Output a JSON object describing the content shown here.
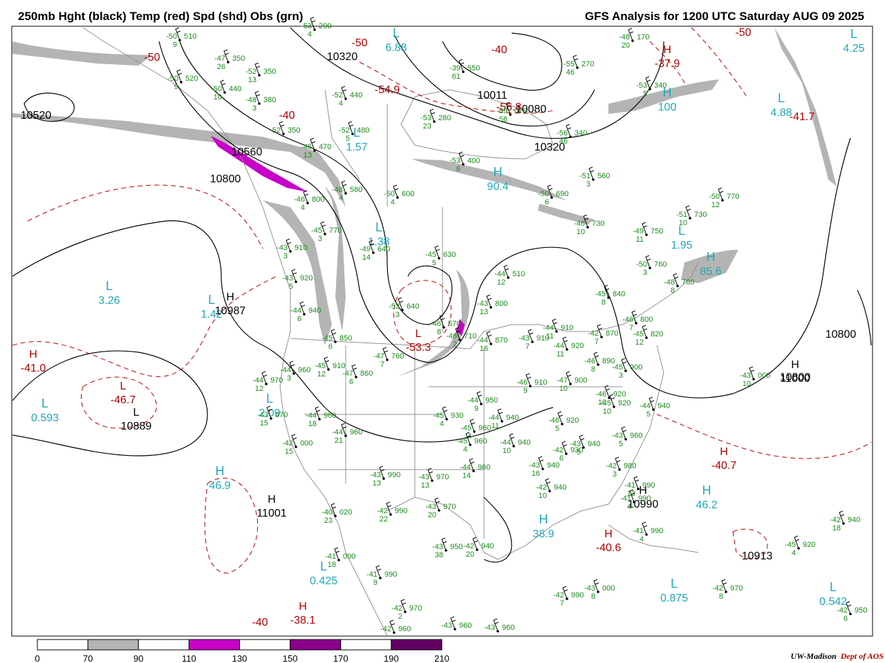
{
  "header": {
    "left_title": "250mb Hght (black) Temp (red) Spd (shd) Obs (grn)",
    "right_title": "GFS Analysis for 1200 UTC Saturday  AUG 09 2025"
  },
  "colorbar": {
    "ticks": [
      "0",
      "70",
      "90",
      "110",
      "130",
      "150",
      "170",
      "190",
      "210"
    ],
    "fills": [
      "#ffffff",
      "#b4b4b4",
      "#ffffff",
      "#c800c8",
      "#ffffff",
      "#8c008c",
      "#ffffff",
      "#640064"
    ]
  },
  "credit": {
    "org": "UW-Madison",
    "dept": "Dept of AOS"
  },
  "map": {
    "pressure_centers": [
      {
        "letter": "L",
        "color": "cyan",
        "value": "3.26"
      },
      {
        "letter": "L",
        "color": "cyan",
        "value": "1.42"
      },
      {
        "letter": "L",
        "color": "cyan",
        "value": "0.593"
      },
      {
        "letter": "L",
        "color": "cyan",
        "value": "1.38"
      },
      {
        "letter": "L",
        "color": "cyan",
        "value": "1.57"
      },
      {
        "letter": "L",
        "color": "cyan",
        "value": "6.88"
      },
      {
        "letter": "L",
        "color": "cyan",
        "value": "4.88"
      },
      {
        "letter": "L",
        "color": "cyan",
        "value": "4.25"
      },
      {
        "letter": "L",
        "color": "cyan",
        "value": "1.95"
      },
      {
        "letter": "L",
        "color": "cyan",
        "value": "0.425"
      },
      {
        "letter": "L",
        "color": "cyan",
        "value": "0.875"
      },
      {
        "letter": "L",
        "color": "cyan",
        "value": "0.542"
      },
      {
        "letter": "L",
        "color": "cyan",
        "value": "2.09"
      },
      {
        "letter": "H",
        "color": "cyan",
        "value": "90.4"
      },
      {
        "letter": "H",
        "color": "cyan",
        "value": "85.6"
      },
      {
        "letter": "H",
        "color": "cyan",
        "value": "46.9"
      },
      {
        "letter": "H",
        "color": "cyan",
        "value": "38.9"
      },
      {
        "letter": "H",
        "color": "cyan",
        "value": "46.2"
      },
      {
        "letter": "H",
        "color": "cyan",
        "value": "100"
      },
      {
        "letter": "H",
        "color": "black",
        "value": "10987"
      },
      {
        "letter": "L",
        "color": "black",
        "value": "10889"
      },
      {
        "letter": "H",
        "color": "black",
        "value": "11001"
      },
      {
        "letter": "H",
        "color": "black",
        "value": "11000"
      },
      {
        "letter": "H",
        "color": "black",
        "value": "10990"
      },
      {
        "letter": "H",
        "color": "red",
        "value": "-41.0"
      },
      {
        "letter": "L",
        "color": "red",
        "value": "-46.7"
      },
      {
        "letter": "H",
        "color": "red",
        "value": "-40.7"
      },
      {
        "letter": "H",
        "color": "red",
        "value": "-40.6"
      },
      {
        "letter": "H",
        "color": "red",
        "value": "-38.1"
      },
      {
        "letter": "L",
        "color": "red",
        "value": "-53.3"
      },
      {
        "letter": "H",
        "color": "red",
        "value": "-37.9"
      }
    ],
    "height_labels": [
      "10320",
      "10011",
      "10080",
      "10320",
      "10800",
      "10800",
      "10800",
      "10560",
      "10520",
      "10913"
    ],
    "temp_labels": [
      "-50",
      "-50",
      "-40",
      "-50",
      "-40",
      "-54.9",
      "-56.8",
      "-41.7",
      "-40"
    ],
    "observations": [
      {
        "temp": "-50",
        "height": "510",
        "speed": "9"
      },
      {
        "temp": "-47",
        "height": "350",
        "speed": "26"
      },
      {
        "temp": "-52",
        "height": "350",
        "speed": "13"
      },
      {
        "temp": "-50",
        "height": "520",
        "speed": "9"
      },
      {
        "temp": "-50",
        "height": "440",
        "speed": "10"
      },
      {
        "temp": "-48",
        "height": "380",
        "speed": "3"
      },
      {
        "temp": "-52",
        "height": "350",
        "speed": ""
      },
      {
        "temp": "-52",
        "height": "440",
        "speed": "4"
      },
      {
        "temp": "-52",
        "height": "480",
        "speed": "5"
      },
      {
        "temp": "-53",
        "height": "290",
        "speed": "4"
      },
      {
        "temp": "-39",
        "height": "550",
        "speed": "61"
      },
      {
        "temp": "-53",
        "height": "280",
        "speed": "23"
      },
      {
        "temp": "-59",
        "height": "070",
        "speed": "58"
      },
      {
        "temp": "-55",
        "height": "270",
        "speed": "46"
      },
      {
        "temp": "-53",
        "height": "340",
        "speed": "5"
      },
      {
        "temp": "-56",
        "height": "340",
        "speed": "46"
      },
      {
        "temp": "-48",
        "height": "170",
        "speed": "20"
      },
      {
        "temp": "-45",
        "height": "470",
        "speed": "13"
      },
      {
        "temp": "-48",
        "height": "580",
        "speed": "4"
      },
      {
        "temp": "-50",
        "height": "600",
        "speed": "4"
      },
      {
        "temp": "-53",
        "height": "400",
        "speed": "6"
      },
      {
        "temp": "-51",
        "height": "560",
        "speed": "3"
      },
      {
        "temp": "-50",
        "height": "690",
        "speed": "6"
      },
      {
        "temp": "-46",
        "height": "800",
        "speed": "4"
      },
      {
        "temp": "-45",
        "height": "770",
        "speed": "3"
      },
      {
        "temp": "-49",
        "height": "640",
        "speed": "14"
      },
      {
        "temp": "-45",
        "height": "630",
        "speed": "5"
      },
      {
        "temp": "-46",
        "height": "730",
        "speed": "10"
      },
      {
        "temp": "-49",
        "height": "750",
        "speed": "11"
      },
      {
        "temp": "-51",
        "height": "730",
        "speed": "10"
      },
      {
        "temp": "-50",
        "height": "770",
        "speed": "12"
      },
      {
        "temp": "-43",
        "height": "910",
        "speed": "3"
      },
      {
        "temp": "-43",
        "height": "920",
        "speed": "5"
      },
      {
        "temp": "-44",
        "height": "940",
        "speed": "6"
      },
      {
        "temp": "-53",
        "height": "640",
        "speed": "3"
      },
      {
        "temp": "-46",
        "height": "570",
        "speed": "8"
      },
      {
        "temp": "-46",
        "height": "710",
        "speed": "2"
      },
      {
        "temp": "-44",
        "height": "510",
        "speed": "12"
      },
      {
        "temp": "-43",
        "height": "800",
        "speed": "13"
      },
      {
        "temp": "-50",
        "height": "760",
        "speed": "3"
      },
      {
        "temp": "-48",
        "height": "780",
        "speed": "8"
      },
      {
        "temp": "-45",
        "height": "840",
        "speed": "8"
      },
      {
        "temp": "-45",
        "height": "850",
        "speed": "6"
      },
      {
        "temp": "-47",
        "height": "760",
        "speed": "7"
      },
      {
        "temp": "-44",
        "height": "870",
        "speed": "16"
      },
      {
        "temp": "-43",
        "height": "910",
        "speed": "7"
      },
      {
        "temp": "-44",
        "height": "910",
        "speed": "11"
      },
      {
        "temp": "-44",
        "height": "920",
        "speed": "11"
      },
      {
        "temp": "-42",
        "height": "870",
        "speed": "7"
      },
      {
        "temp": "-46",
        "height": "800",
        "speed": "7"
      },
      {
        "temp": "-45",
        "height": "820",
        "speed": "12"
      },
      {
        "temp": "-44",
        "height": "960",
        "speed": "3"
      },
      {
        "temp": "-45",
        "height": "910",
        "speed": "12"
      },
      {
        "temp": "-47",
        "height": "860",
        "speed": "6"
      },
      {
        "temp": "-44",
        "height": "970",
        "speed": "12"
      },
      {
        "temp": "-43",
        "height": "970",
        "speed": "15"
      },
      {
        "temp": "-44",
        "height": "960",
        "speed": "18"
      },
      {
        "temp": "-44",
        "height": "960",
        "speed": "21"
      },
      {
        "temp": "-42",
        "height": "000",
        "speed": "15"
      },
      {
        "temp": "-46",
        "height": "910",
        "speed": "9"
      },
      {
        "temp": "-47",
        "height": "900",
        "speed": "10"
      },
      {
        "temp": "-46",
        "height": "890",
        "speed": "8"
      },
      {
        "temp": "-45",
        "height": "900",
        "speed": "3"
      },
      {
        "temp": "-46",
        "height": "920",
        "speed": "10"
      },
      {
        "temp": "-45",
        "height": "920",
        "speed": "10"
      },
      {
        "temp": "-44",
        "height": "940",
        "speed": "5"
      },
      {
        "temp": "-43",
        "height": "000",
        "speed": "10"
      },
      {
        "temp": "-44",
        "height": "950",
        "speed": "9"
      },
      {
        "temp": "-45",
        "height": "930",
        "speed": "4"
      },
      {
        "temp": "-45",
        "height": "960",
        "speed": "4"
      },
      {
        "temp": "-44",
        "height": "940",
        "speed": "11"
      },
      {
        "temp": "-46",
        "height": "920",
        "speed": "5"
      },
      {
        "temp": "-45",
        "height": "960",
        "speed": "4"
      },
      {
        "temp": "-44",
        "height": "940",
        "speed": "10"
      },
      {
        "temp": "-43",
        "height": "940",
        "speed": "5"
      },
      {
        "temp": "-42",
        "height": "930",
        "speed": "6"
      },
      {
        "temp": "-43",
        "height": "960",
        "speed": "5"
      },
      {
        "temp": "-44",
        "height": "960",
        "speed": "14"
      },
      {
        "temp": "-43",
        "height": "940",
        "speed": "16"
      },
      {
        "temp": "-42",
        "height": "980",
        "speed": "3"
      },
      {
        "temp": "-43",
        "height": "990",
        "speed": "13"
      },
      {
        "temp": "-43",
        "height": "970",
        "speed": "13"
      },
      {
        "temp": "-42",
        "height": "940",
        "speed": "10"
      },
      {
        "temp": "-41",
        "height": "990",
        "speed": "13"
      },
      {
        "temp": "-41",
        "height": "990",
        "speed": "4"
      },
      {
        "temp": "-41",
        "height": "990",
        "speed": "4"
      },
      {
        "temp": "-40",
        "height": "020",
        "speed": "23"
      },
      {
        "temp": "-42",
        "height": "990",
        "speed": "22"
      },
      {
        "temp": "-43",
        "height": "970",
        "speed": "20"
      },
      {
        "temp": "-43",
        "height": "950",
        "speed": "38"
      },
      {
        "temp": "-42",
        "height": "940",
        "speed": "20"
      },
      {
        "temp": "-41",
        "height": "000",
        "speed": "18"
      },
      {
        "temp": "-41",
        "height": "990",
        "speed": "9"
      },
      {
        "temp": "-42",
        "height": "970",
        "speed": "2"
      },
      {
        "temp": "-42",
        "height": "960",
        "speed": ""
      },
      {
        "temp": "-43",
        "height": "960",
        "speed": ""
      },
      {
        "temp": "-43",
        "height": "960",
        "speed": ""
      },
      {
        "temp": "-42",
        "height": "990",
        "speed": "7"
      },
      {
        "temp": "-43",
        "height": "000",
        "speed": "8"
      },
      {
        "temp": "-42",
        "height": "970",
        "speed": "8"
      },
      {
        "temp": "-42",
        "height": "950",
        "speed": "6"
      },
      {
        "temp": "-45",
        "height": "920",
        "speed": "4"
      },
      {
        "temp": "-42",
        "height": "940",
        "speed": "18"
      }
    ]
  },
  "colors": {
    "height": "#000000",
    "temp": "#b00000",
    "obs": "#1a8a1a",
    "cyan_centers": "#1fa8b8",
    "jet_70_90": "#b4b4b4",
    "jet_110_130": "#c800c8"
  }
}
